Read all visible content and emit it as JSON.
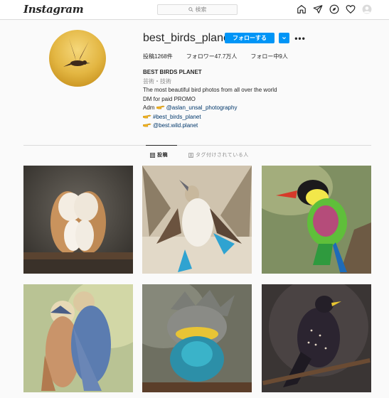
{
  "app": {
    "logo_text": "Instagram"
  },
  "search": {
    "placeholder": "検索"
  },
  "nav_icons": [
    "home-icon",
    "direct-icon",
    "explore-icon",
    "activity-icon",
    "profile-avatar-icon"
  ],
  "profile": {
    "username": "best_birds_planet",
    "follow_label": "フォローする",
    "stats": {
      "posts": "投稿1268件",
      "followers": "フォロワー47.7万人",
      "following": "フォロー中9人"
    },
    "bio": {
      "name": "BEST BIRDS PLANET",
      "category": "芸術・技術",
      "line1": "The most beautiful bird photos from all over the world",
      "line2": "DM for paid PROMO",
      "adm_prefix": "Adm",
      "adm_handle": "@aslan_unsal_photography",
      "hashtag": "#best_birds_planet",
      "other_account": "@best.wild.planet"
    }
  },
  "tabs": [
    {
      "label": "投稿",
      "active": true
    },
    {
      "label": "タグ付けされている人",
      "active": false
    }
  ],
  "posts": [
    {
      "subject": "barn owls"
    },
    {
      "subject": "blue-footed booby"
    },
    {
      "subject": "colorful bird"
    },
    {
      "subject": "kestrels"
    },
    {
      "subject": "fluffy kingfisher"
    },
    {
      "subject": "starling"
    }
  ],
  "colors": {
    "accent": "#0095f6",
    "link": "#00376b",
    "muted": "#8e8e8e",
    "text": "#262626"
  }
}
